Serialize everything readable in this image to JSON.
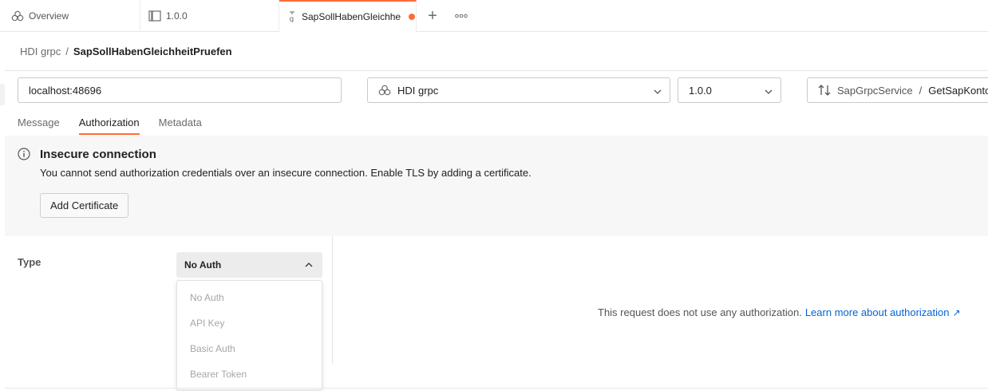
{
  "tabs": [
    {
      "label": "Overview",
      "icon": "overview-icon"
    },
    {
      "label": "1.0.0",
      "icon": "api-icon"
    },
    {
      "label": "SapSollHabenGleichhe",
      "icon": "grpc-icon",
      "unsaved": true
    }
  ],
  "tab_actions": {
    "add": "+",
    "more_icon": "more-icon"
  },
  "breadcrumb": {
    "parent": "HDI grpc",
    "separator": "/",
    "current": "SapSollHabenGleichheitPruefen"
  },
  "request": {
    "url": "localhost:48696",
    "service": "HDI grpc",
    "version": "1.0.0",
    "method_service": "SapGrpcService",
    "method_separator": "/",
    "method_name": "GetSapKontos"
  },
  "subtabs": [
    "Message",
    "Authorization",
    "Metadata"
  ],
  "active_subtab": "Authorization",
  "alert": {
    "title": "Insecure connection",
    "body": "You cannot send authorization credentials over an insecure connection. Enable TLS by adding a certificate.",
    "button": "Add Certificate"
  },
  "auth": {
    "type_label": "Type",
    "selected": "No Auth",
    "options": [
      "No Auth",
      "API Key",
      "Basic Auth",
      "Bearer Token"
    ],
    "message": "This request does not use any authorization.",
    "link": "Learn more about authorization",
    "link_arrow": "↗"
  },
  "colors": {
    "accent": "#ff6c37",
    "link": "#0265d2"
  }
}
